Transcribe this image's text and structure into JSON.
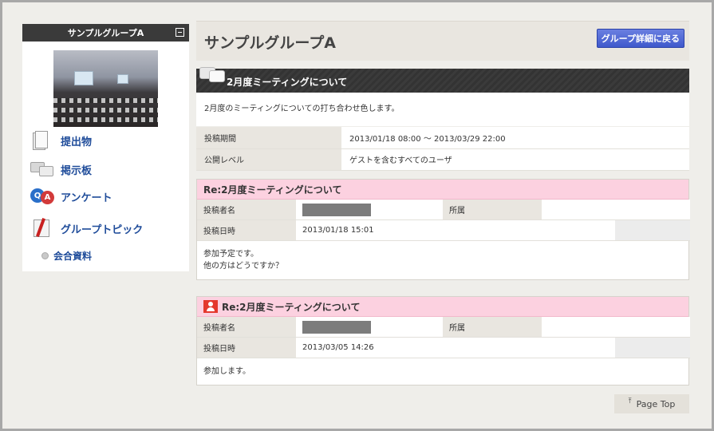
{
  "sidebar": {
    "group_name": "サンプルグループA",
    "nav_items": [
      {
        "label": "提出物",
        "icon": "document-icon"
      },
      {
        "label": "掲示板",
        "icon": "board-icon"
      },
      {
        "label": "アンケート",
        "icon": "qa-icon"
      },
      {
        "label": "グループトピック",
        "icon": "topic-icon"
      }
    ],
    "sub_items": [
      {
        "label": "会合資料"
      }
    ]
  },
  "header": {
    "title": "サンプルグループA",
    "back_button": "グループ詳細に戻る"
  },
  "topic": {
    "title": "2月度ミーティングについて",
    "description": "2月度のミーティングについての打ち合わせ色します。",
    "info": [
      {
        "label": "投稿期間",
        "value": "2013/01/18 08:00 〜 2013/03/29 22:00"
      },
      {
        "label": "公開レベル",
        "value": "ゲストを含むすべてのユーザ"
      }
    ]
  },
  "posts": [
    {
      "title": "Re:2月度ミーティングについて",
      "has_user_icon": false,
      "author_label": "投稿者名",
      "affiliation_label": "所属",
      "date_label": "投稿日時",
      "date": "2013/01/18 15:01",
      "body": [
        "参加予定です。",
        "他の方はどうですか？"
      ]
    },
    {
      "title": "Re:2月度ミーティングについて",
      "has_user_icon": true,
      "author_label": "投稿者名",
      "affiliation_label": "所属",
      "date_label": "投稿日時",
      "date": "2013/03/05 14:26",
      "body": [
        "参加します。"
      ]
    }
  ],
  "footer": {
    "page_top": "Page Top"
  },
  "colors": {
    "dark_bar": "#333333",
    "post_header": "#fcd1e0",
    "link": "#1f4c9a",
    "button": "#3f59cc"
  }
}
